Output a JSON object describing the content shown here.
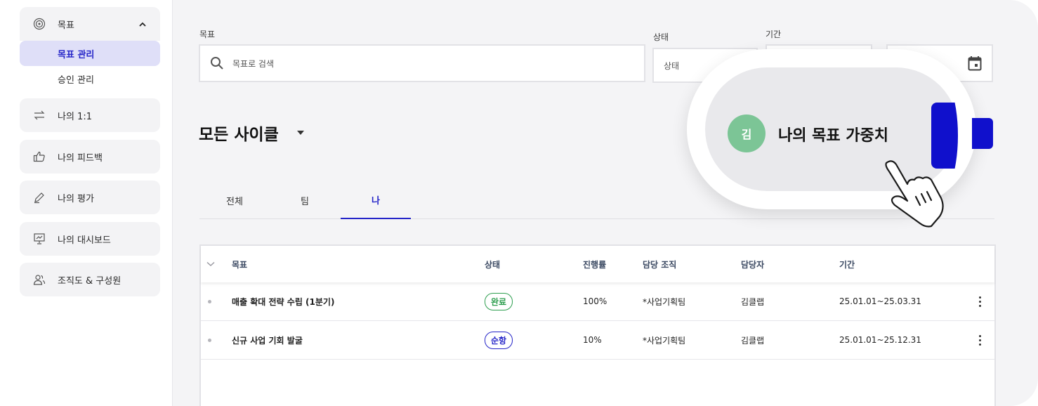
{
  "sidebar": {
    "goal_group": {
      "label": "목표",
      "chevron": "chevron-up-icon",
      "items": [
        {
          "label": "목표 관리",
          "active": true
        },
        {
          "label": "승인 관리",
          "active": false
        }
      ]
    },
    "items": [
      {
        "label": "나의 1:1",
        "icon": "one-on-one-icon"
      },
      {
        "label": "나의 피드백",
        "icon": "thumbs-up-icon"
      },
      {
        "label": "나의 평가",
        "icon": "pen-icon"
      },
      {
        "label": "나의 대시보드",
        "icon": "dashboard-icon"
      },
      {
        "label": "조직도 & 구성원",
        "icon": "people-icon"
      }
    ]
  },
  "filters": {
    "goal_label": "목표",
    "search_placeholder": "목표로 검색",
    "status_label": "상태",
    "status_value": "상태",
    "period_label": "기간"
  },
  "cycle": {
    "title": "모든 사이클"
  },
  "tabs": [
    {
      "label": "전체",
      "active": false
    },
    {
      "label": "팀",
      "active": false
    },
    {
      "label": "나",
      "active": true
    }
  ],
  "table": {
    "headers": [
      "목표",
      "상태",
      "진행률",
      "담당 조직",
      "담당자",
      "기간"
    ],
    "rows": [
      {
        "goal": "매출 확대 전략 수립 (1분기)",
        "status": "완료",
        "status_color": "#2e9e4f",
        "progress": "100%",
        "org": "*사업기획팀",
        "owner": "김클랩",
        "period": "25.01.01~25.03.31"
      },
      {
        "goal": "신규 사업 기회 발굴",
        "status": "순항",
        "status_color": "#2424c8",
        "progress": "10%",
        "org": "*사업기획팀",
        "owner": "김클랩",
        "period": "25.01.01~25.12.31"
      }
    ]
  },
  "callout": {
    "avatar": "김",
    "text": "나의 목표 가중치",
    "avatar_color": "#7cc596",
    "accent": "#1010cc"
  }
}
